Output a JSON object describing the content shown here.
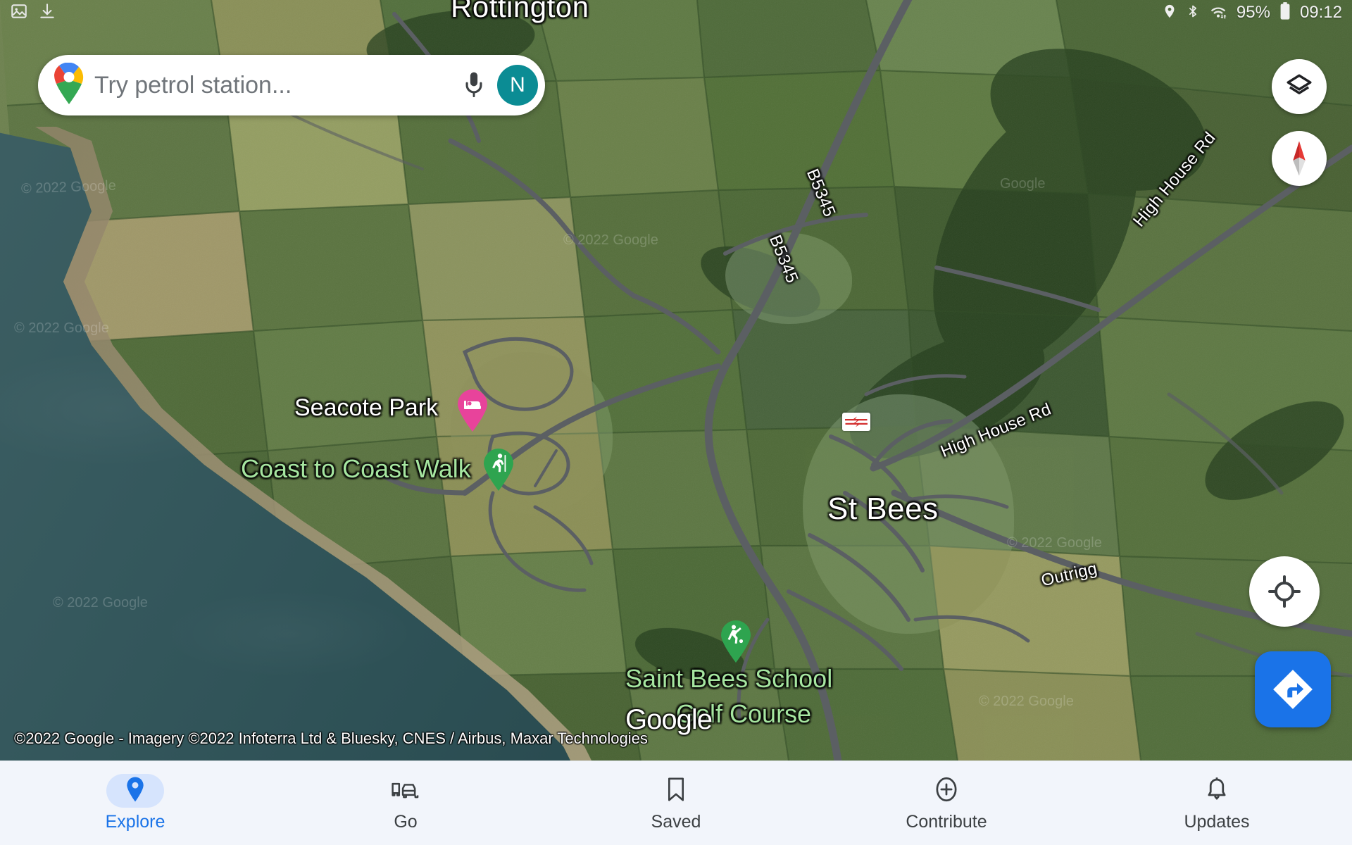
{
  "app": {
    "name": "Google Maps",
    "view": "satellite"
  },
  "status_bar": {
    "icons": [
      "location-icon",
      "bluetooth-icon",
      "wifi-icon"
    ],
    "battery_percent": "95%",
    "time": "09:12"
  },
  "top_left_icons": [
    "image-icon",
    "download-icon"
  ],
  "search": {
    "placeholder": "Try petrol station...",
    "value": "",
    "logo": "google-maps-pin-logo",
    "mic_icon": "microphone-icon",
    "avatar_initial": "N",
    "avatar_color": "#0b8c94"
  },
  "map_controls": {
    "layers_label": "Layers",
    "compass_label": "Compass",
    "my_location_label": "My location",
    "directions_label": "Directions"
  },
  "map": {
    "place_labels": [
      {
        "name": "Rottington",
        "style": "white"
      },
      {
        "name": "St Bees",
        "style": "white"
      },
      {
        "name": "Seacote Park",
        "style": "white"
      },
      {
        "name": "Coast to Coast Walk",
        "style": "green"
      },
      {
        "name": "Saint Bees School",
        "style": "green"
      },
      {
        "name": "Golf Course",
        "style": "green"
      }
    ],
    "road_labels": [
      "B5345",
      "B5345",
      "High House Rd",
      "High House Rd",
      "Outrigg"
    ],
    "markers": [
      {
        "name": "Seacote Park",
        "icon": "hotel-bed-icon",
        "color": "#e8439b"
      },
      {
        "name": "Coast to Coast Walk",
        "icon": "hiking-icon",
        "color": "#34a853"
      },
      {
        "name": "Saint Bees School Golf Course",
        "icon": "golf-icon",
        "color": "#34a853"
      },
      {
        "name": "St Bees Station",
        "icon": "national-rail-icon",
        "color": "#d32f2f"
      }
    ],
    "watermark": "Google",
    "attribution": "©2022 Google - Imagery ©2022 Infoterra Ltd & Bluesky, CNES / Airbus, Maxar Technologies",
    "ghost_attributions": [
      "2022 Google",
      "2022 Google",
      "2022 Google",
      "Google",
      "2022 Google"
    ],
    "colors": {
      "water": "#35585d",
      "land": "#6b7f4e",
      "label_green": "#a6e6a0"
    }
  },
  "bottom_nav": {
    "items": [
      {
        "label": "Explore",
        "icon": "map-pin-icon",
        "active": true
      },
      {
        "label": "Go",
        "icon": "commute-icon",
        "active": false
      },
      {
        "label": "Saved",
        "icon": "bookmark-icon",
        "active": false
      },
      {
        "label": "Contribute",
        "icon": "plus-circle-icon",
        "active": false
      },
      {
        "label": "Updates",
        "icon": "bell-icon",
        "active": false
      }
    ],
    "active_color": "#1a73e8"
  }
}
